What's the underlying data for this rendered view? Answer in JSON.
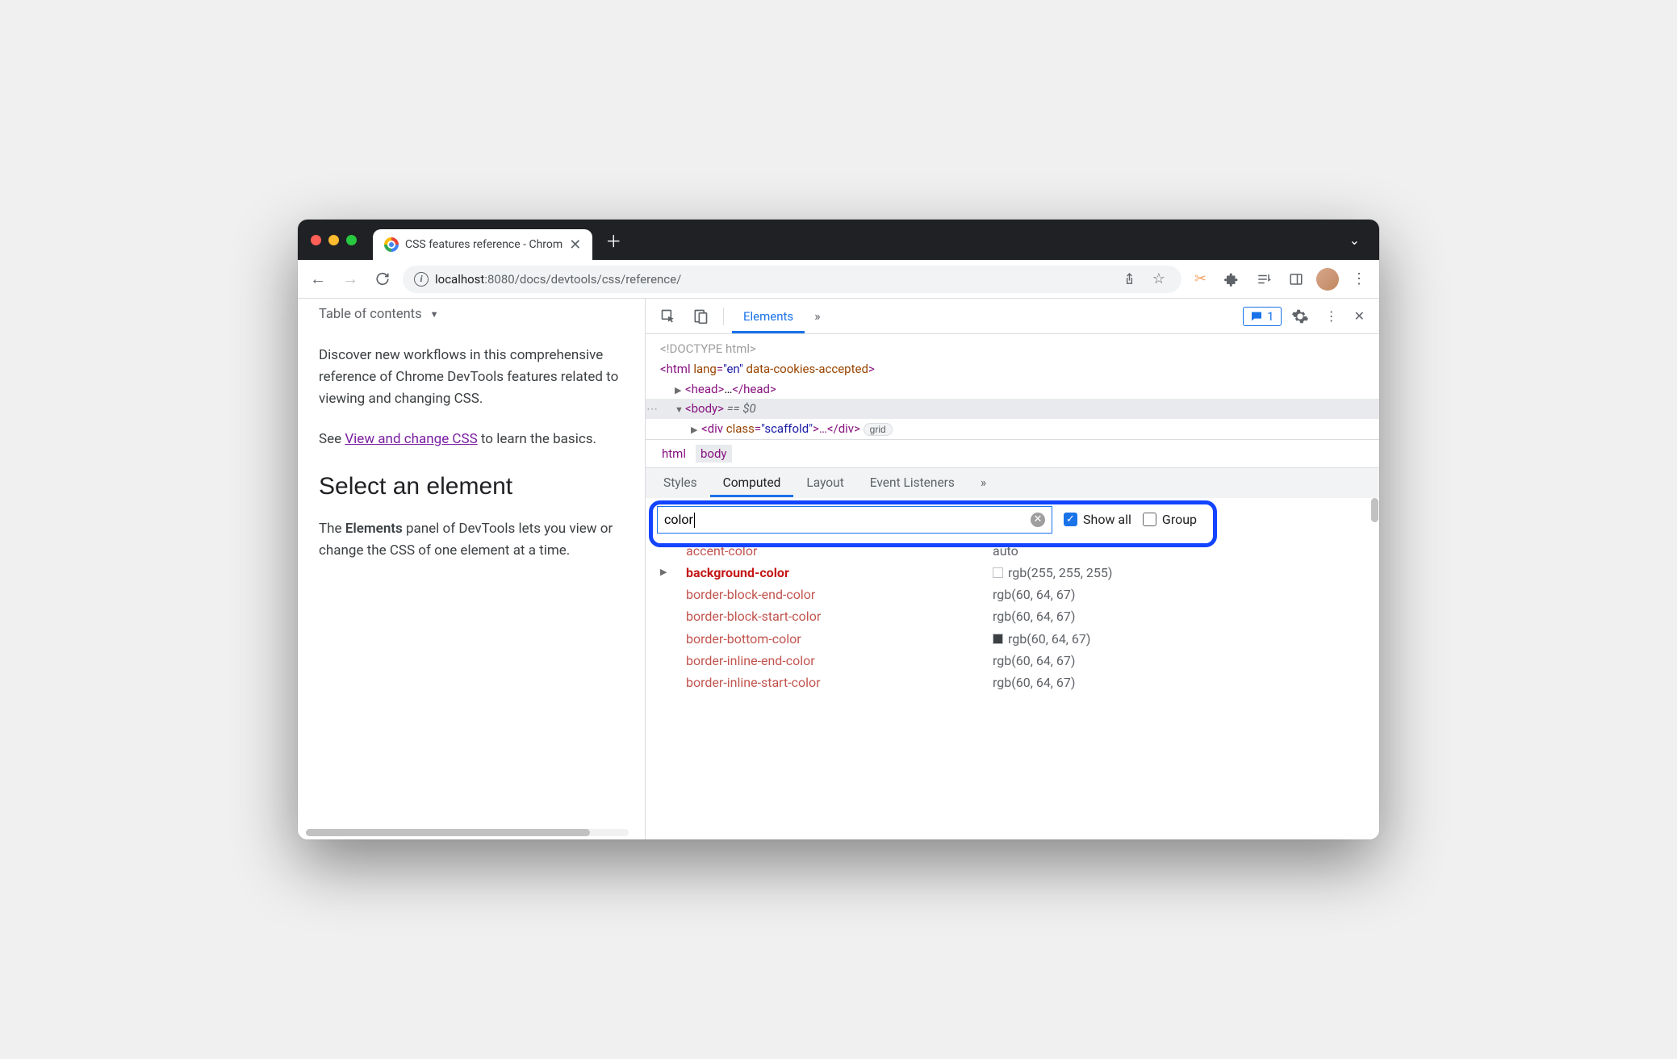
{
  "browser": {
    "tab_title": "CSS features reference - Chrom",
    "url_host": "localhost",
    "url_port": ":8080",
    "url_path": "/docs/devtools/css/reference/"
  },
  "page": {
    "toc": "Table of contents",
    "p1": "Discover new workflows in this comprehensive reference of Chrome DevTools features related to viewing and changing CSS.",
    "p2_a": "See ",
    "p2_link": "View and change CSS",
    "p2_b": " to learn the basics.",
    "h2": "Select an element",
    "p3_a": "The ",
    "p3_strong": "Elements",
    "p3_b": " panel of DevTools lets you view or change the CSS of one element at a time."
  },
  "devtools": {
    "tab_elements": "Elements",
    "msg_count": "1",
    "dom": {
      "doctype": "<!DOCTYPE html>",
      "html_open": "<html",
      "html_attr1_n": "lang",
      "html_attr1_v": "\"en\"",
      "html_attr2_n": "data-cookies-accepted",
      "html_close": ">",
      "head": "<head>",
      "head_mid": "…",
      "head_end": "</head>",
      "body": "<body>",
      "body_eq": " == ",
      "body_sel": "$0",
      "div_open": "<div",
      "div_attr_n": "class",
      "div_attr_v": "\"scaffold\"",
      "div_mid": ">…",
      "div_end": "</div>",
      "badge": "grid"
    },
    "crumb1": "html",
    "crumb2": "body",
    "styles_tabs": {
      "styles": "Styles",
      "computed": "Computed",
      "layout": "Layout",
      "listeners": "Event Listeners"
    },
    "filter_value": "color",
    "show_all": "Show all",
    "group": "Group",
    "props": [
      {
        "name": "accent-color",
        "value": "auto",
        "exp": false,
        "swatch": null
      },
      {
        "name": "background-color",
        "value": "rgb(255, 255, 255)",
        "exp": true,
        "bold": true,
        "swatch": "white"
      },
      {
        "name": "border-block-end-color",
        "value": "rgb(60, 64, 67)",
        "exp": false,
        "swatch": null
      },
      {
        "name": "border-block-start-color",
        "value": "rgb(60, 64, 67)",
        "exp": false,
        "swatch": null
      },
      {
        "name": "border-bottom-color",
        "value": "rgb(60, 64, 67)",
        "exp": false,
        "swatch": "gray"
      },
      {
        "name": "border-inline-end-color",
        "value": "rgb(60, 64, 67)",
        "exp": false,
        "swatch": null
      },
      {
        "name": "border-inline-start-color",
        "value": "rgb(60, 64, 67)",
        "exp": false,
        "swatch": null
      }
    ]
  }
}
